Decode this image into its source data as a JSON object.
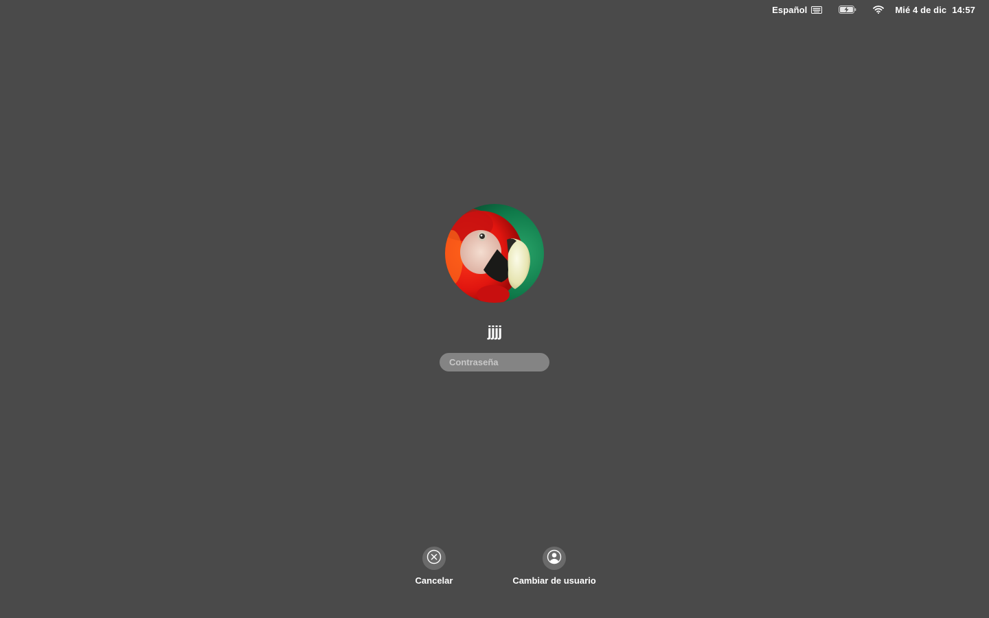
{
  "menubar": {
    "input_language": "Español",
    "keyboard_icon": "keyboard-icon",
    "battery_icon": "battery-charging-icon",
    "wifi_icon": "wifi-icon",
    "date": "Mié 4 de dic",
    "time": "14:57"
  },
  "login": {
    "avatar_icon": "parrot-avatar",
    "username": "jjjj",
    "password_placeholder": "Contraseña"
  },
  "actions": {
    "cancel_label": "Cancelar",
    "cancel_icon": "cancel-x-icon",
    "switch_user_label": "Cambiar de usuario",
    "switch_user_icon": "user-circle-icon"
  },
  "colors": {
    "background": "#4a4a4a",
    "text": "#ffffff"
  }
}
